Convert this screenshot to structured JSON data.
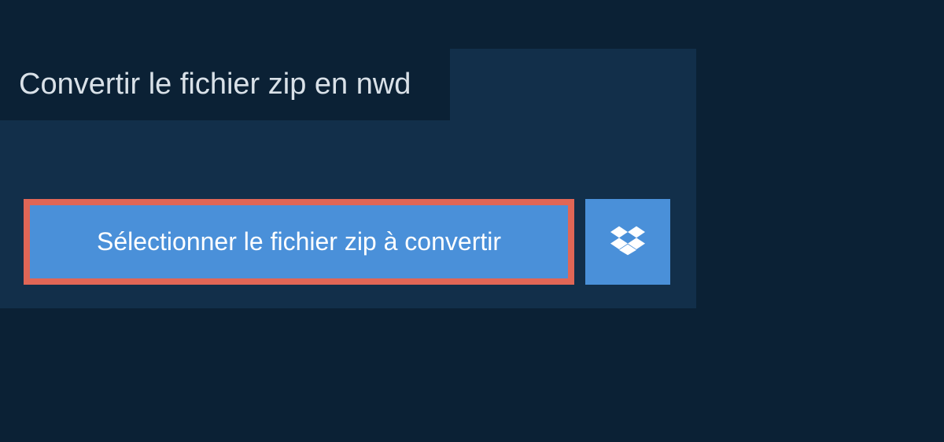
{
  "title": "Convertir le fichier zip en nwd",
  "selectButton": {
    "label": "Sélectionner le fichier zip à convertir"
  },
  "colors": {
    "background": "#0b2135",
    "panel": "#122f4a",
    "button": "#4a90d9",
    "highlight": "#e06656",
    "text": "#d9e1e8",
    "buttonText": "#ffffff"
  }
}
